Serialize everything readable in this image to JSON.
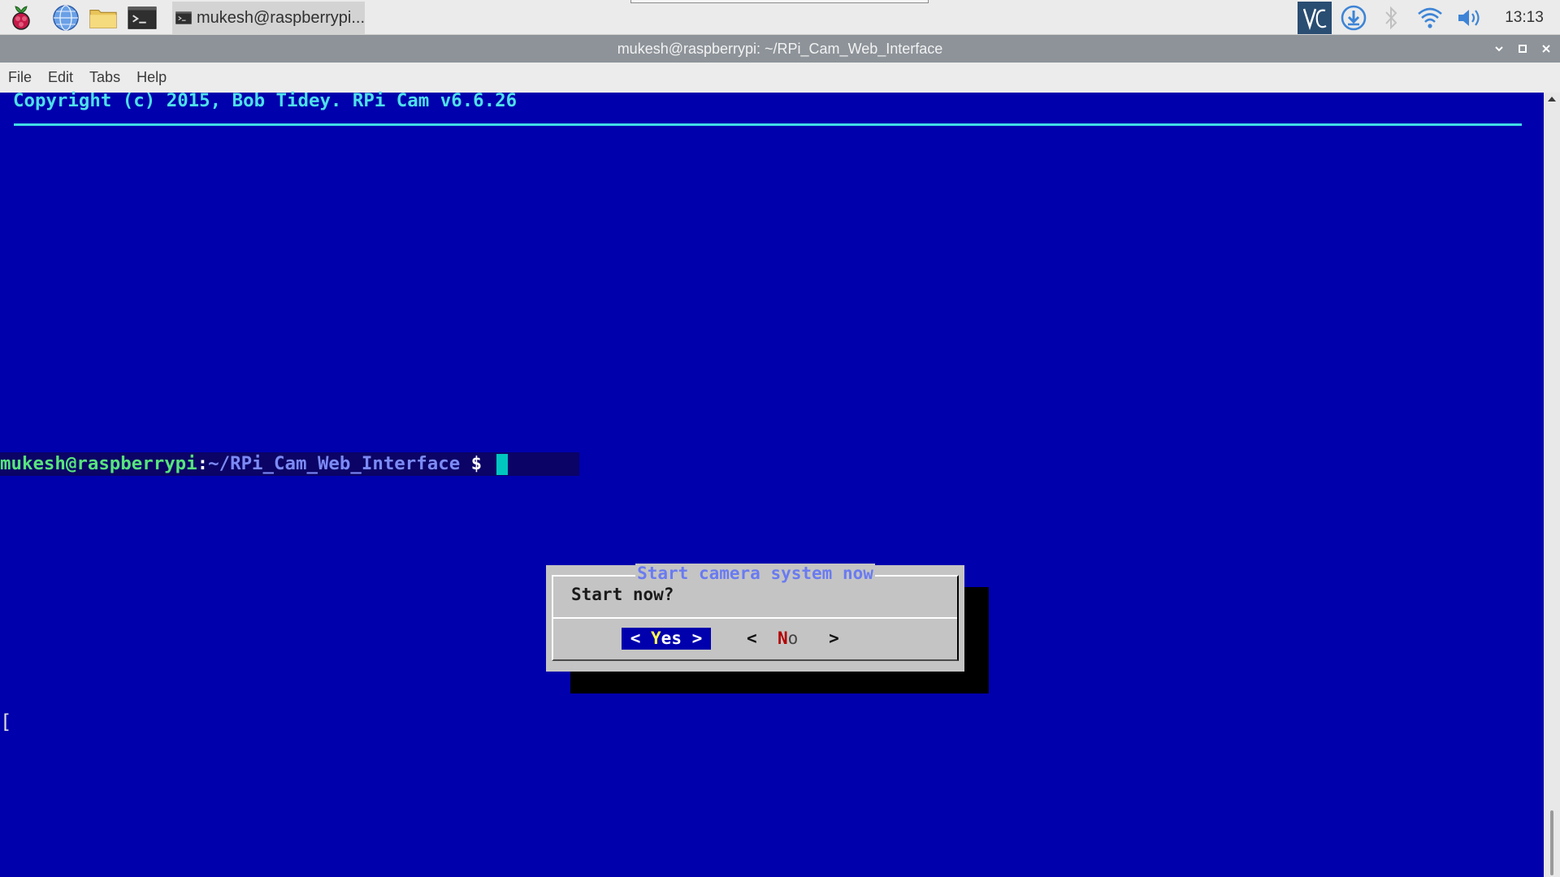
{
  "taskbar": {
    "task_label": "mukesh@raspberrypi...",
    "clock": "13:13",
    "icons": [
      "raspberry-pi-menu-icon",
      "web-browser-icon",
      "file-manager-icon",
      "terminal-icon",
      "vnc-server-icon",
      "updater-icon",
      "bluetooth-icon",
      "wifi-icon",
      "volume-icon"
    ]
  },
  "window": {
    "title": "mukesh@raspberrypi: ~/RPi_Cam_Web_Interface",
    "menu": [
      "File",
      "Edit",
      "Tabs",
      "Help"
    ]
  },
  "terminal": {
    "copyright": "Copyright (c) 2015, Bob Tidey. RPi Cam v6.6.26",
    "prompt_user": "mukesh@raspberrypi",
    "prompt_colon": ":",
    "prompt_path": "~/RPi_Cam_Web_Interface",
    "prompt_dollar": " $ ",
    "stray_char": "[",
    "colors": {
      "background": "#0000ad",
      "copyright": "#4fdfe9",
      "user": "#57e47c",
      "path": "#7c8af5",
      "cursor": "#00c6c0"
    }
  },
  "dialog": {
    "title": "Start camera system now",
    "message": "Start now?",
    "yes_left": "< ",
    "yes_hot": "Y",
    "yes_rest": "es",
    "yes_right": " >",
    "no_left": "<  ",
    "no_hot": "N",
    "no_rest": "o",
    "no_right": "   >",
    "colors": {
      "body": "#c4c4c4",
      "title": "#6a7bf0",
      "selected_button": "#0000ad",
      "hotkey_selected": "#ffff54",
      "hotkey": "#b30000"
    }
  }
}
